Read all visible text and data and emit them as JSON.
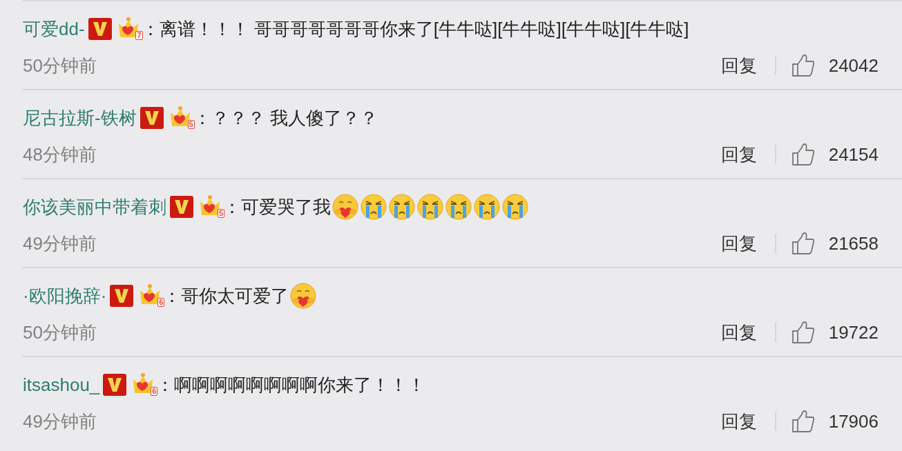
{
  "comments": [
    {
      "user": "可爱dd-",
      "vip": true,
      "crown_level": "7",
      "content": [
        {
          "kind": "text",
          "text": "：离谱！！！ 哥哥哥哥哥哥哥你来了[牛牛哒][牛牛哒][牛牛哒][牛牛哒]"
        }
      ],
      "time": "50分钟前",
      "reply": "回复",
      "likes": "24042"
    },
    {
      "user": "尼古拉斯-铁树",
      "vip": true,
      "crown_level": "5",
      "content": [
        {
          "kind": "text",
          "text": "：？？？ 我人傻了？？"
        }
      ],
      "time": "48分钟前",
      "reply": "回复",
      "likes": "24154"
    },
    {
      "user": "你该美丽中带着刺",
      "vip": true,
      "crown_level": "5",
      "content": [
        {
          "kind": "text",
          "text": "：可爱哭了我"
        },
        {
          "kind": "hug"
        },
        {
          "kind": "cry"
        },
        {
          "kind": "cry"
        },
        {
          "kind": "cry"
        },
        {
          "kind": "cry"
        },
        {
          "kind": "cry"
        },
        {
          "kind": "cry"
        }
      ],
      "time": "49分钟前",
      "reply": "回复",
      "likes": "21658"
    },
    {
      "user": "·欧阳挽辞·",
      "vip": true,
      "crown_level": "6",
      "content": [
        {
          "kind": "text",
          "text": "：哥你太可爱了"
        },
        {
          "kind": "hug"
        }
      ],
      "time": "50分钟前",
      "reply": "回复",
      "likes": "19722"
    },
    {
      "user": "itsashou_",
      "vip": true,
      "crown_level": "6",
      "content": [
        {
          "kind": "text",
          "text": "：啊啊啊啊啊啊啊啊你来了！！！"
        }
      ],
      "time": "49分钟前",
      "reply": "回复",
      "likes": "17906"
    }
  ]
}
